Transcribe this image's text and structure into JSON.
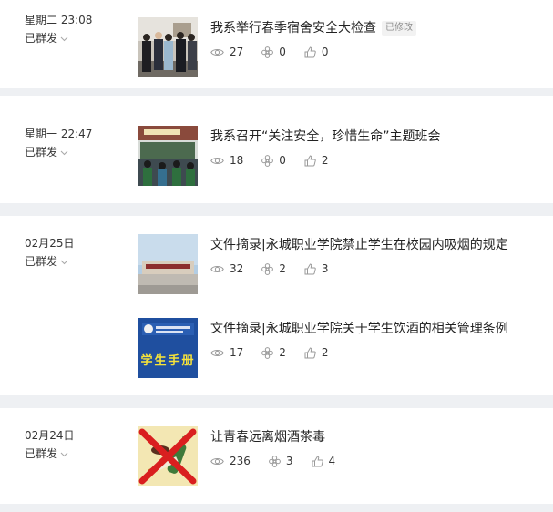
{
  "groups": [
    {
      "date": "星期二 23:08",
      "status": "已群发",
      "articles": [
        {
          "title": "我系举行春季宿舍安全大检查",
          "tag": "已修改",
          "views": "27",
          "wows": "0",
          "likes": "0",
          "thumb_icon": "group-photo-thumbnail"
        }
      ]
    },
    {
      "date": "星期一 22:47",
      "status": "已群发",
      "articles": [
        {
          "title": "我系召开“关注安全，珍惜生命”主题班会",
          "views": "18",
          "wows": "0",
          "likes": "2",
          "thumb_icon": "classroom-photo-thumbnail"
        }
      ]
    },
    {
      "date": "02月25日",
      "status": "已群发",
      "articles": [
        {
          "title": "文件摘录|永城职业学院禁止学生在校园内吸烟的规定",
          "views": "32",
          "wows": "2",
          "likes": "3",
          "thumb_icon": "campus-gate-thumbnail"
        },
        {
          "title": "文件摘录|永城职业学院关于学生饮酒的相关管理条例",
          "views": "17",
          "wows": "2",
          "likes": "2",
          "thumb_icon": "student-handbook-thumbnail",
          "thumb_text": "学生手册"
        }
      ]
    },
    {
      "date": "02月24日",
      "status": "已群发",
      "articles": [
        {
          "title": "让青春远离烟酒茶毒",
          "views": "236",
          "wows": "3",
          "likes": "4",
          "thumb_icon": "no-smoking-drinking-thumbnail"
        }
      ]
    }
  ],
  "colors": {
    "page_bg": "#eef0f3",
    "card_bg": "#ffffff",
    "text": "#353535",
    "meta": "#8d8d8d"
  }
}
